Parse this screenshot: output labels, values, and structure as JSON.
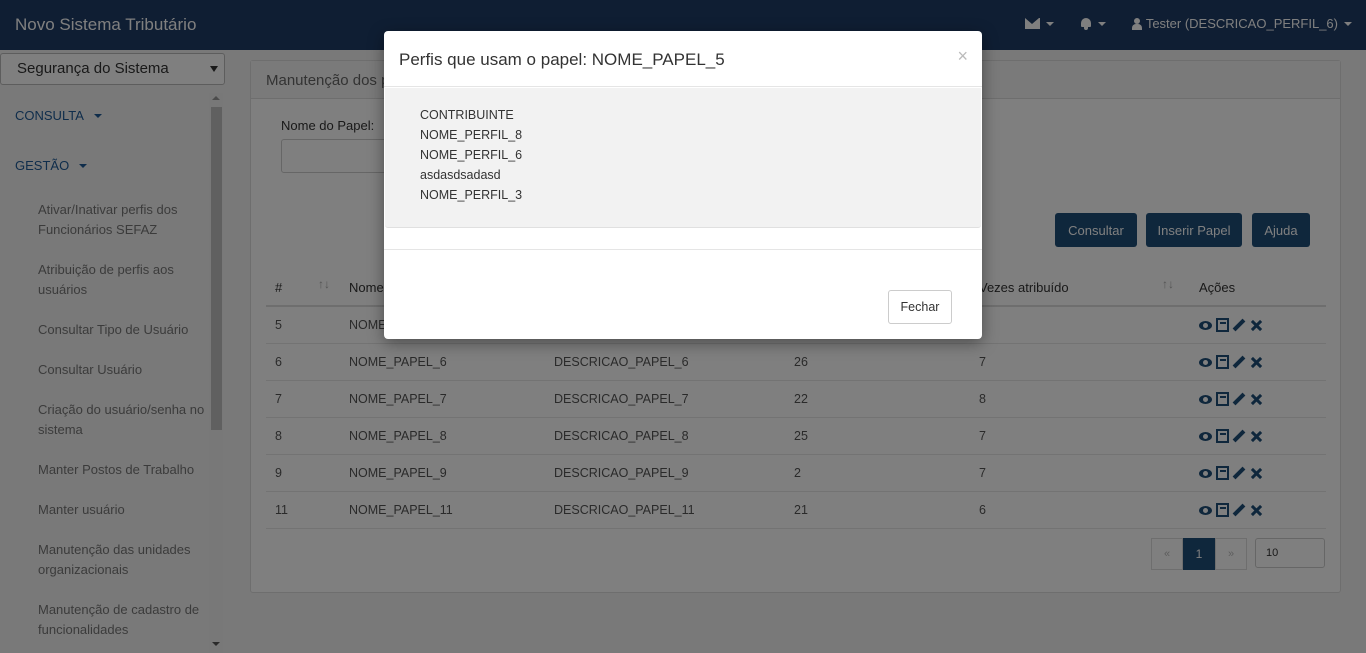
{
  "app": {
    "title": "Novo Sistema Tributário"
  },
  "navbar": {
    "user_label": "Tester (DESCRICAO_PERFIL_6)"
  },
  "sidebar": {
    "module_select": "Segurança do Sistema",
    "sections": [
      {
        "label": "CONSULTA"
      },
      {
        "label": "GESTÃO"
      }
    ],
    "items": [
      {
        "label": "Ativar/Inativar perfis dos Funcionários SEFAZ"
      },
      {
        "label": "Atribuição de perfis aos usuários"
      },
      {
        "label": "Consultar Tipo de Usuário"
      },
      {
        "label": "Consultar Usuário"
      },
      {
        "label": "Criação do usuário/senha no sistema"
      },
      {
        "label": "Manter Postos de Trabalho"
      },
      {
        "label": "Manter usuário"
      },
      {
        "label": "Manutenção das unidades organizacionais"
      },
      {
        "label": "Manutenção de cadastro de funcionalidades"
      }
    ]
  },
  "panel": {
    "heading": "Manutenção dos p",
    "field_label": "Nome do Papel:",
    "buttons": {
      "consultar": "Consultar",
      "inserir": "Inserir Papel",
      "ajuda": "Ajuda"
    },
    "table": {
      "headers": [
        "#",
        "Nome",
        "",
        "",
        "Vezes atribuído",
        "Ações"
      ],
      "rows": [
        [
          "5",
          "NOME",
          "",
          "",
          ""
        ],
        [
          "6",
          "NOME_PAPEL_6",
          "DESCRICAO_PAPEL_6",
          "26",
          "7"
        ],
        [
          "7",
          "NOME_PAPEL_7",
          "DESCRICAO_PAPEL_7",
          "22",
          "8"
        ],
        [
          "8",
          "NOME_PAPEL_8",
          "DESCRICAO_PAPEL_8",
          "25",
          "7"
        ],
        [
          "9",
          "NOME_PAPEL_9",
          "DESCRICAO_PAPEL_9",
          "2",
          "7"
        ],
        [
          "11",
          "NOME_PAPEL_11",
          "DESCRICAO_PAPEL_11",
          "21",
          "6"
        ]
      ]
    },
    "pagination": {
      "prev": "«",
      "current": "1",
      "next": "»",
      "page_size": "10"
    }
  },
  "modal": {
    "title": "Perfis que usam o papel: NOME_PAPEL_5",
    "close_symbol": "×",
    "profiles": [
      "CONTRIBUINTE",
      "NOME_PERFIL_8",
      "NOME_PERFIL_6",
      "asdasdsadasd",
      "NOME_PERFIL_3"
    ],
    "close_button": "Fechar"
  }
}
